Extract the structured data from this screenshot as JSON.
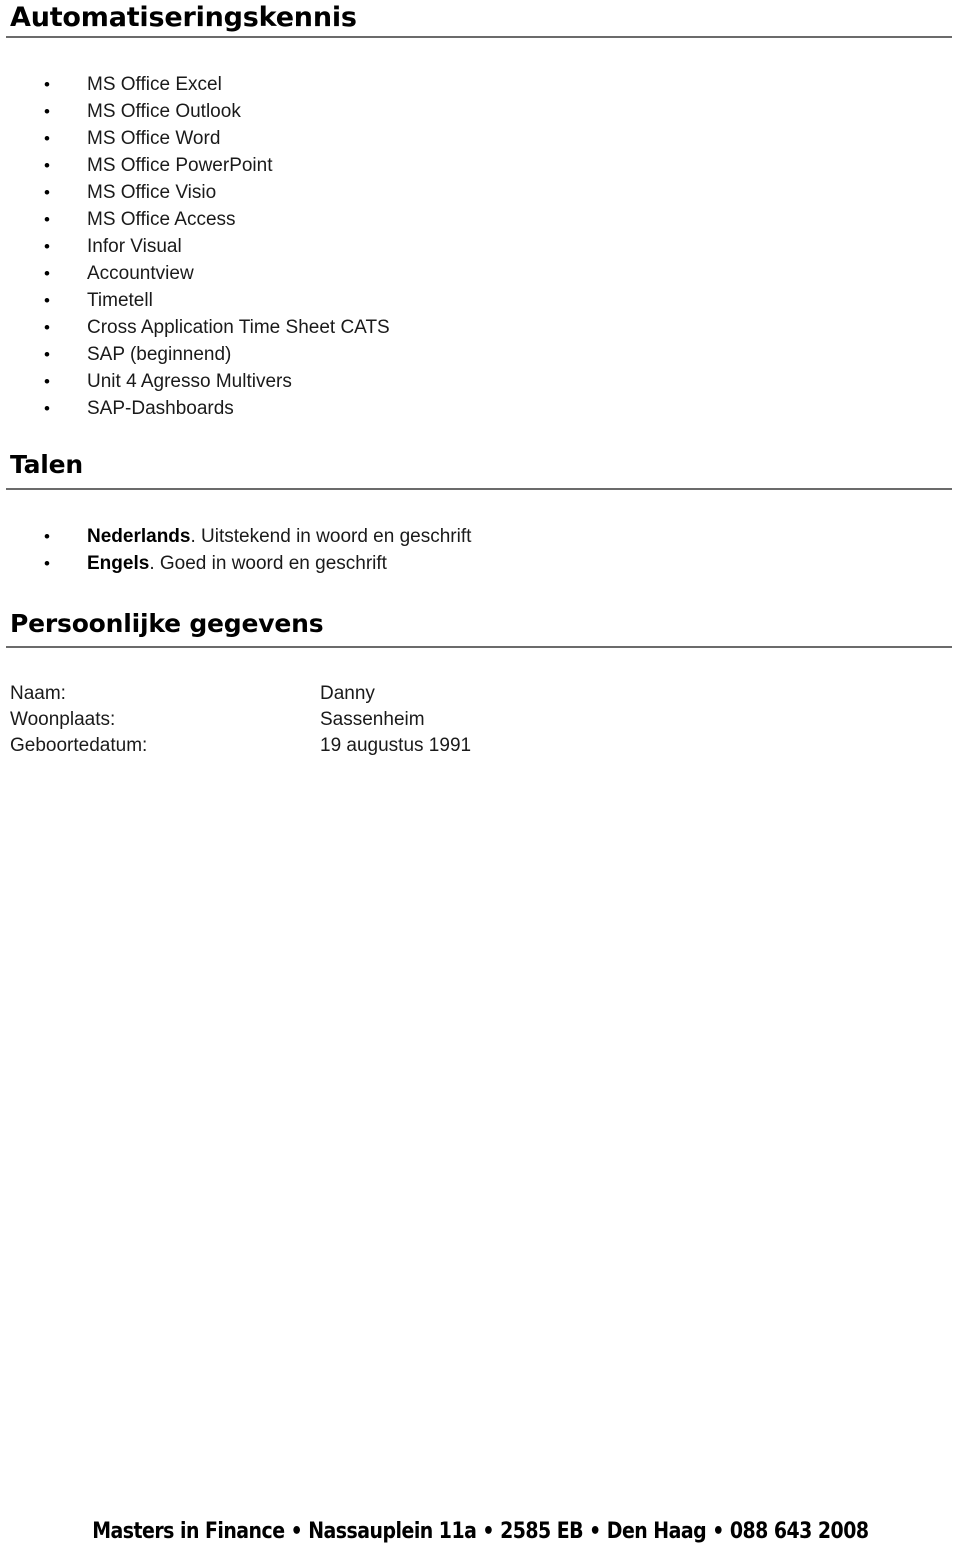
{
  "document": {
    "sections": [
      {
        "heading": "Automatiseringskennis",
        "items": [
          "MS Office Excel",
          "MS Office Outlook",
          "MS Office Word",
          "MS Office PowerPoint",
          "MS Office Visio",
          "MS Office Access",
          "Infor Visual",
          "Accountview",
          "Timetell",
          "Cross Application Time Sheet CATS",
          "SAP (beginnend)",
          "Unit 4 Agresso Multivers",
          "SAP-Dashboards"
        ]
      },
      {
        "heading": "Talen",
        "items": [
          {
            "label": "Nederlands",
            "text": ". Uitstekend in woord en geschrift"
          },
          {
            "label": "Engels",
            "text": ". Goed in woord en geschrift"
          }
        ]
      },
      {
        "heading": "Persoonlijke gegevens",
        "rows": [
          {
            "label": "Naam:",
            "value": "Danny"
          },
          {
            "label": "Woonplaats:",
            "value": "Sassenheim"
          },
          {
            "label": "Geboortedatum:",
            "value": "19 augustus 1991"
          }
        ]
      }
    ],
    "bullet_glyph": "•",
    "footer": "Masters in Finance • Nassauplein 11a • 2585 EB • Den Haag • 088 643 2008",
    "colors": {
      "text": "#1a1a1a",
      "heading": "#000000",
      "rule": "#6b6b6b",
      "background": "#ffffff"
    }
  }
}
